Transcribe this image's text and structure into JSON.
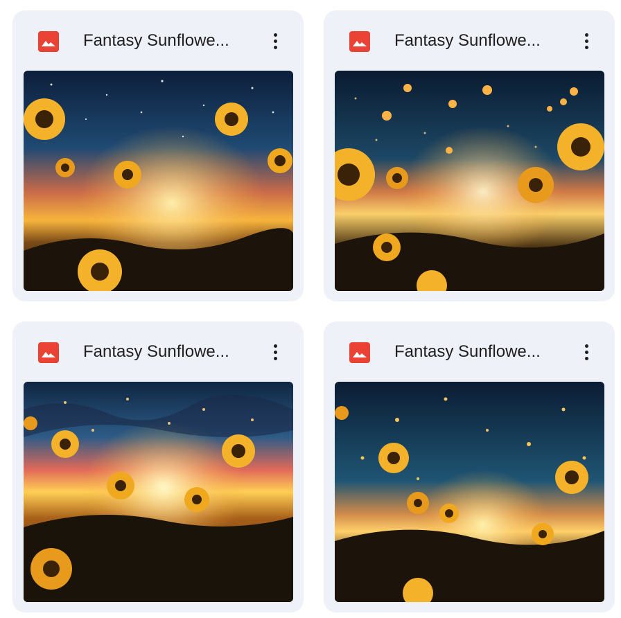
{
  "files": [
    {
      "name": "Fantasy Sunflowe...",
      "icon": "image-file-icon",
      "icon_color": "#ea4335",
      "thumbnail": "sunflower-field-night-sky"
    },
    {
      "name": "Fantasy Sunflowe...",
      "icon": "image-file-icon",
      "icon_color": "#ea4335",
      "thumbnail": "sunflower-field-fireflies"
    },
    {
      "name": "Fantasy Sunflowe...",
      "icon": "image-file-icon",
      "icon_color": "#ea4335",
      "thumbnail": "sunflower-field-sunset"
    },
    {
      "name": "Fantasy Sunflowe...",
      "icon": "image-file-icon",
      "icon_color": "#ea4335",
      "thumbnail": "sunflower-field-starry-dusk"
    }
  ],
  "colors": {
    "card_background": "#eef2f8",
    "title_text": "#1f1f1f",
    "accent": "#ea4335"
  }
}
